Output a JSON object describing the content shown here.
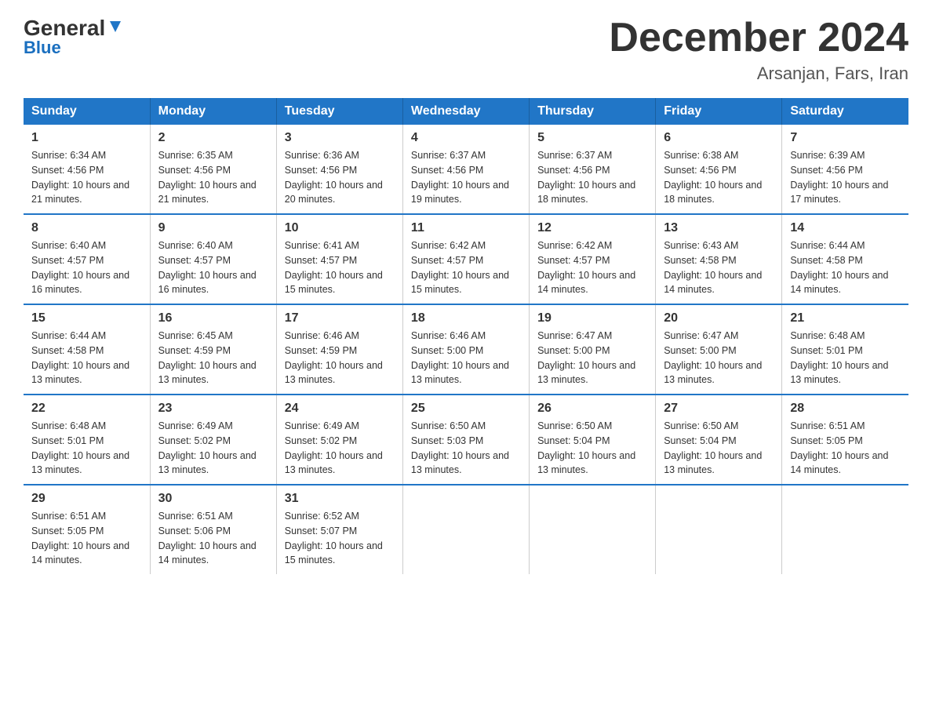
{
  "header": {
    "logo_general": "General",
    "logo_blue": "Blue",
    "month_year": "December 2024",
    "location": "Arsanjan, Fars, Iran"
  },
  "days_of_week": [
    "Sunday",
    "Monday",
    "Tuesday",
    "Wednesday",
    "Thursday",
    "Friday",
    "Saturday"
  ],
  "weeks": [
    [
      {
        "day": "1",
        "sunrise": "6:34 AM",
        "sunset": "4:56 PM",
        "daylight": "10 hours and 21 minutes."
      },
      {
        "day": "2",
        "sunrise": "6:35 AM",
        "sunset": "4:56 PM",
        "daylight": "10 hours and 21 minutes."
      },
      {
        "day": "3",
        "sunrise": "6:36 AM",
        "sunset": "4:56 PM",
        "daylight": "10 hours and 20 minutes."
      },
      {
        "day": "4",
        "sunrise": "6:37 AM",
        "sunset": "4:56 PM",
        "daylight": "10 hours and 19 minutes."
      },
      {
        "day": "5",
        "sunrise": "6:37 AM",
        "sunset": "4:56 PM",
        "daylight": "10 hours and 18 minutes."
      },
      {
        "day": "6",
        "sunrise": "6:38 AM",
        "sunset": "4:56 PM",
        "daylight": "10 hours and 18 minutes."
      },
      {
        "day": "7",
        "sunrise": "6:39 AM",
        "sunset": "4:56 PM",
        "daylight": "10 hours and 17 minutes."
      }
    ],
    [
      {
        "day": "8",
        "sunrise": "6:40 AM",
        "sunset": "4:57 PM",
        "daylight": "10 hours and 16 minutes."
      },
      {
        "day": "9",
        "sunrise": "6:40 AM",
        "sunset": "4:57 PM",
        "daylight": "10 hours and 16 minutes."
      },
      {
        "day": "10",
        "sunrise": "6:41 AM",
        "sunset": "4:57 PM",
        "daylight": "10 hours and 15 minutes."
      },
      {
        "day": "11",
        "sunrise": "6:42 AM",
        "sunset": "4:57 PM",
        "daylight": "10 hours and 15 minutes."
      },
      {
        "day": "12",
        "sunrise": "6:42 AM",
        "sunset": "4:57 PM",
        "daylight": "10 hours and 14 minutes."
      },
      {
        "day": "13",
        "sunrise": "6:43 AM",
        "sunset": "4:58 PM",
        "daylight": "10 hours and 14 minutes."
      },
      {
        "day": "14",
        "sunrise": "6:44 AM",
        "sunset": "4:58 PM",
        "daylight": "10 hours and 14 minutes."
      }
    ],
    [
      {
        "day": "15",
        "sunrise": "6:44 AM",
        "sunset": "4:58 PM",
        "daylight": "10 hours and 13 minutes."
      },
      {
        "day": "16",
        "sunrise": "6:45 AM",
        "sunset": "4:59 PM",
        "daylight": "10 hours and 13 minutes."
      },
      {
        "day": "17",
        "sunrise": "6:46 AM",
        "sunset": "4:59 PM",
        "daylight": "10 hours and 13 minutes."
      },
      {
        "day": "18",
        "sunrise": "6:46 AM",
        "sunset": "5:00 PM",
        "daylight": "10 hours and 13 minutes."
      },
      {
        "day": "19",
        "sunrise": "6:47 AM",
        "sunset": "5:00 PM",
        "daylight": "10 hours and 13 minutes."
      },
      {
        "day": "20",
        "sunrise": "6:47 AM",
        "sunset": "5:00 PM",
        "daylight": "10 hours and 13 minutes."
      },
      {
        "day": "21",
        "sunrise": "6:48 AM",
        "sunset": "5:01 PM",
        "daylight": "10 hours and 13 minutes."
      }
    ],
    [
      {
        "day": "22",
        "sunrise": "6:48 AM",
        "sunset": "5:01 PM",
        "daylight": "10 hours and 13 minutes."
      },
      {
        "day": "23",
        "sunrise": "6:49 AM",
        "sunset": "5:02 PM",
        "daylight": "10 hours and 13 minutes."
      },
      {
        "day": "24",
        "sunrise": "6:49 AM",
        "sunset": "5:02 PM",
        "daylight": "10 hours and 13 minutes."
      },
      {
        "day": "25",
        "sunrise": "6:50 AM",
        "sunset": "5:03 PM",
        "daylight": "10 hours and 13 minutes."
      },
      {
        "day": "26",
        "sunrise": "6:50 AM",
        "sunset": "5:04 PM",
        "daylight": "10 hours and 13 minutes."
      },
      {
        "day": "27",
        "sunrise": "6:50 AM",
        "sunset": "5:04 PM",
        "daylight": "10 hours and 13 minutes."
      },
      {
        "day": "28",
        "sunrise": "6:51 AM",
        "sunset": "5:05 PM",
        "daylight": "10 hours and 14 minutes."
      }
    ],
    [
      {
        "day": "29",
        "sunrise": "6:51 AM",
        "sunset": "5:05 PM",
        "daylight": "10 hours and 14 minutes."
      },
      {
        "day": "30",
        "sunrise": "6:51 AM",
        "sunset": "5:06 PM",
        "daylight": "10 hours and 14 minutes."
      },
      {
        "day": "31",
        "sunrise": "6:52 AM",
        "sunset": "5:07 PM",
        "daylight": "10 hours and 15 minutes."
      },
      null,
      null,
      null,
      null
    ]
  ]
}
